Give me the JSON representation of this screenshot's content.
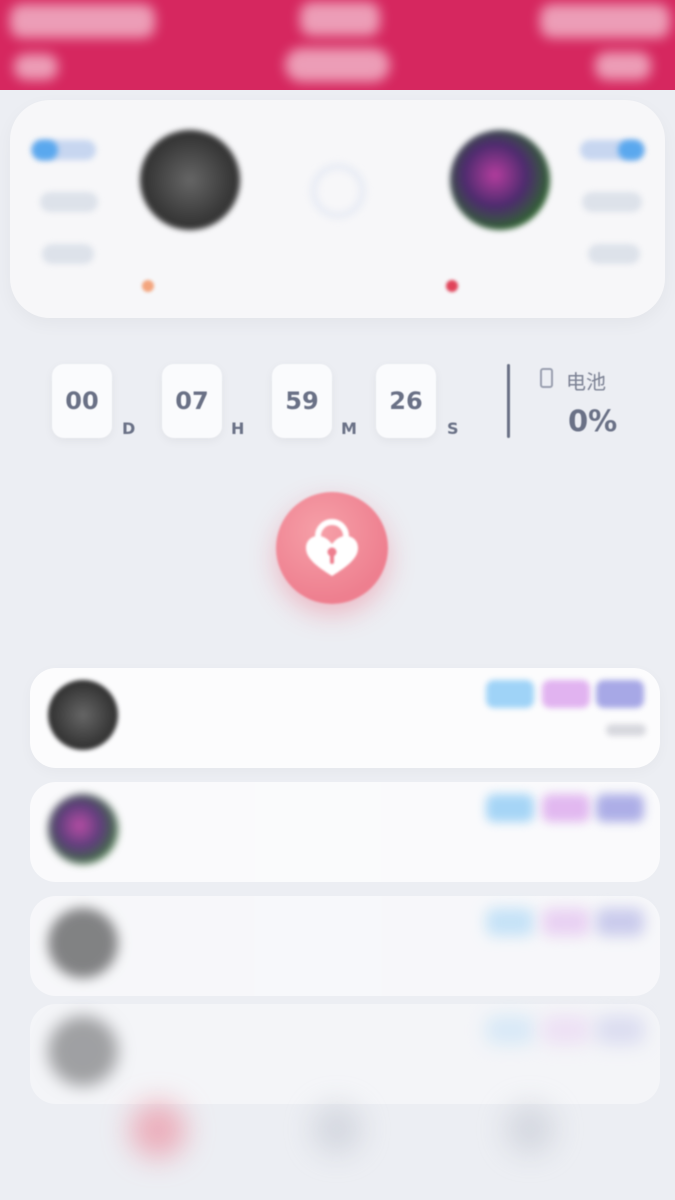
{
  "header": {
    "left_label": "",
    "center_label": "",
    "right_label": ""
  },
  "profile": {
    "left_user": {
      "name": "",
      "status_color": "#f3a57e"
    },
    "right_user": {
      "name": "",
      "status_color": "#e0445a"
    }
  },
  "timer": {
    "days": "00",
    "days_unit": "D",
    "hours": "07",
    "hours_unit": "H",
    "minutes": "59",
    "minutes_unit": "M",
    "seconds": "26",
    "seconds_unit": "S"
  },
  "battery": {
    "label": "电池",
    "value": "0%"
  },
  "records": {
    "section_label": "",
    "items": [
      {
        "name": ""
      },
      {
        "name": ""
      },
      {
        "name": ""
      },
      {
        "name": ""
      }
    ]
  },
  "colors": {
    "header": "#d6275f",
    "lock_button": "#ee7f8f",
    "tag_blue": "#9fd3f7",
    "tag_purple": "#e1b3f0",
    "tag_indigo": "#a7a8e6"
  },
  "icons": {
    "lock": "heart-lock-icon",
    "battery": "battery-icon",
    "link": "link-icon"
  }
}
